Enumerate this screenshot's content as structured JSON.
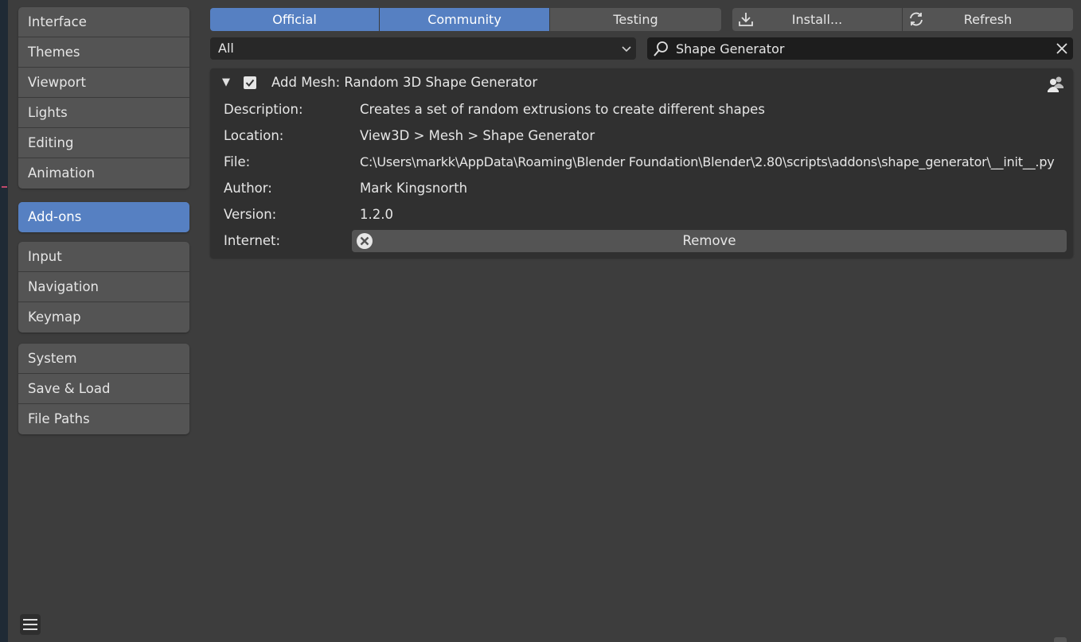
{
  "sidebar": {
    "groups": [
      {
        "items": [
          {
            "label": "Interface"
          },
          {
            "label": "Themes"
          },
          {
            "label": "Viewport"
          },
          {
            "label": "Lights"
          },
          {
            "label": "Editing"
          },
          {
            "label": "Animation"
          }
        ]
      },
      {
        "items": [
          {
            "label": "Add-ons",
            "active": true
          }
        ]
      },
      {
        "items": [
          {
            "label": "Input"
          },
          {
            "label": "Navigation"
          },
          {
            "label": "Keymap"
          }
        ]
      },
      {
        "items": [
          {
            "label": "System"
          },
          {
            "label": "Save & Load"
          },
          {
            "label": "File Paths"
          }
        ]
      }
    ]
  },
  "toolbar": {
    "tabs": [
      {
        "label": "Official",
        "active": true
      },
      {
        "label": "Community",
        "active": true
      },
      {
        "label": "Testing",
        "active": false
      }
    ],
    "install_label": "Install...",
    "refresh_label": "Refresh"
  },
  "filter": {
    "category": "All"
  },
  "search": {
    "value": "Shape Generator"
  },
  "addon": {
    "title": "Add Mesh: Random 3D Shape Generator",
    "enabled": true,
    "rows": {
      "description": {
        "label": "Description:",
        "value": "Creates a set of random extrusions to create different shapes"
      },
      "location": {
        "label": "Location:",
        "value": "View3D > Mesh > Shape Generator"
      },
      "file": {
        "label": "File:",
        "value": "C:\\Users\\markk\\AppData\\Roaming\\Blender Foundation\\Blender\\2.80\\scripts\\addons\\shape_generator\\__init__.py"
      },
      "author": {
        "label": "Author:",
        "value": "Mark Kingsnorth"
      },
      "version": {
        "label": "Version:",
        "value": "1.2.0"
      },
      "internet": {
        "label": "Internet:"
      }
    },
    "remove_label": "Remove"
  },
  "colors": {
    "accent": "#5680c2",
    "panel_bg": "#3d3d3d",
    "button_bg": "#545454"
  }
}
